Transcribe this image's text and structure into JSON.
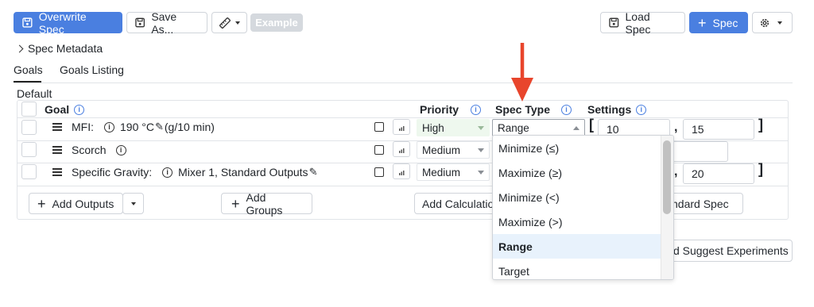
{
  "toolbar": {
    "overwrite_label": "Overwrite Spec",
    "save_as_label": "Save As...",
    "example_label": "Example",
    "load_label": "Load Spec",
    "add_spec_label": "Spec"
  },
  "metadata_label": "Spec Metadata",
  "tabs": [
    "Goals",
    "Goals Listing"
  ],
  "group_label": "Default",
  "headers": {
    "goal": "Goal",
    "priority": "Priority",
    "spec_type": "Spec Type",
    "settings": "Settings"
  },
  "rows": [
    {
      "name": "MFI:",
      "detail": "190 °C",
      "unit": "(g/10 min)",
      "priority": "High",
      "spec_type": "Range",
      "min": "10",
      "max": "15"
    },
    {
      "name": "Scorch",
      "priority": "Medium"
    },
    {
      "name": "Specific Gravity:",
      "detail": "Mixer 1, Standard Outputs",
      "priority": "Medium",
      "max": "20"
    }
  ],
  "footer": {
    "add_outputs": "Add Outputs",
    "add_groups": "Add Groups",
    "add_calc": "Add Calculation",
    "std_spec": "ndard Spec",
    "suggest": "d Suggest Experiments"
  },
  "dropdown": {
    "options": [
      "Minimize (≤)",
      "Maximize (≥)",
      "Minimize (<)",
      "Maximize (>)",
      "Range",
      "Target"
    ],
    "selected": "Range"
  },
  "colors": {
    "primary": "#4a7fe0",
    "arrow": "#e8452c",
    "highlight": "#e8f2fc",
    "priority_bg": "#eef8ee"
  }
}
